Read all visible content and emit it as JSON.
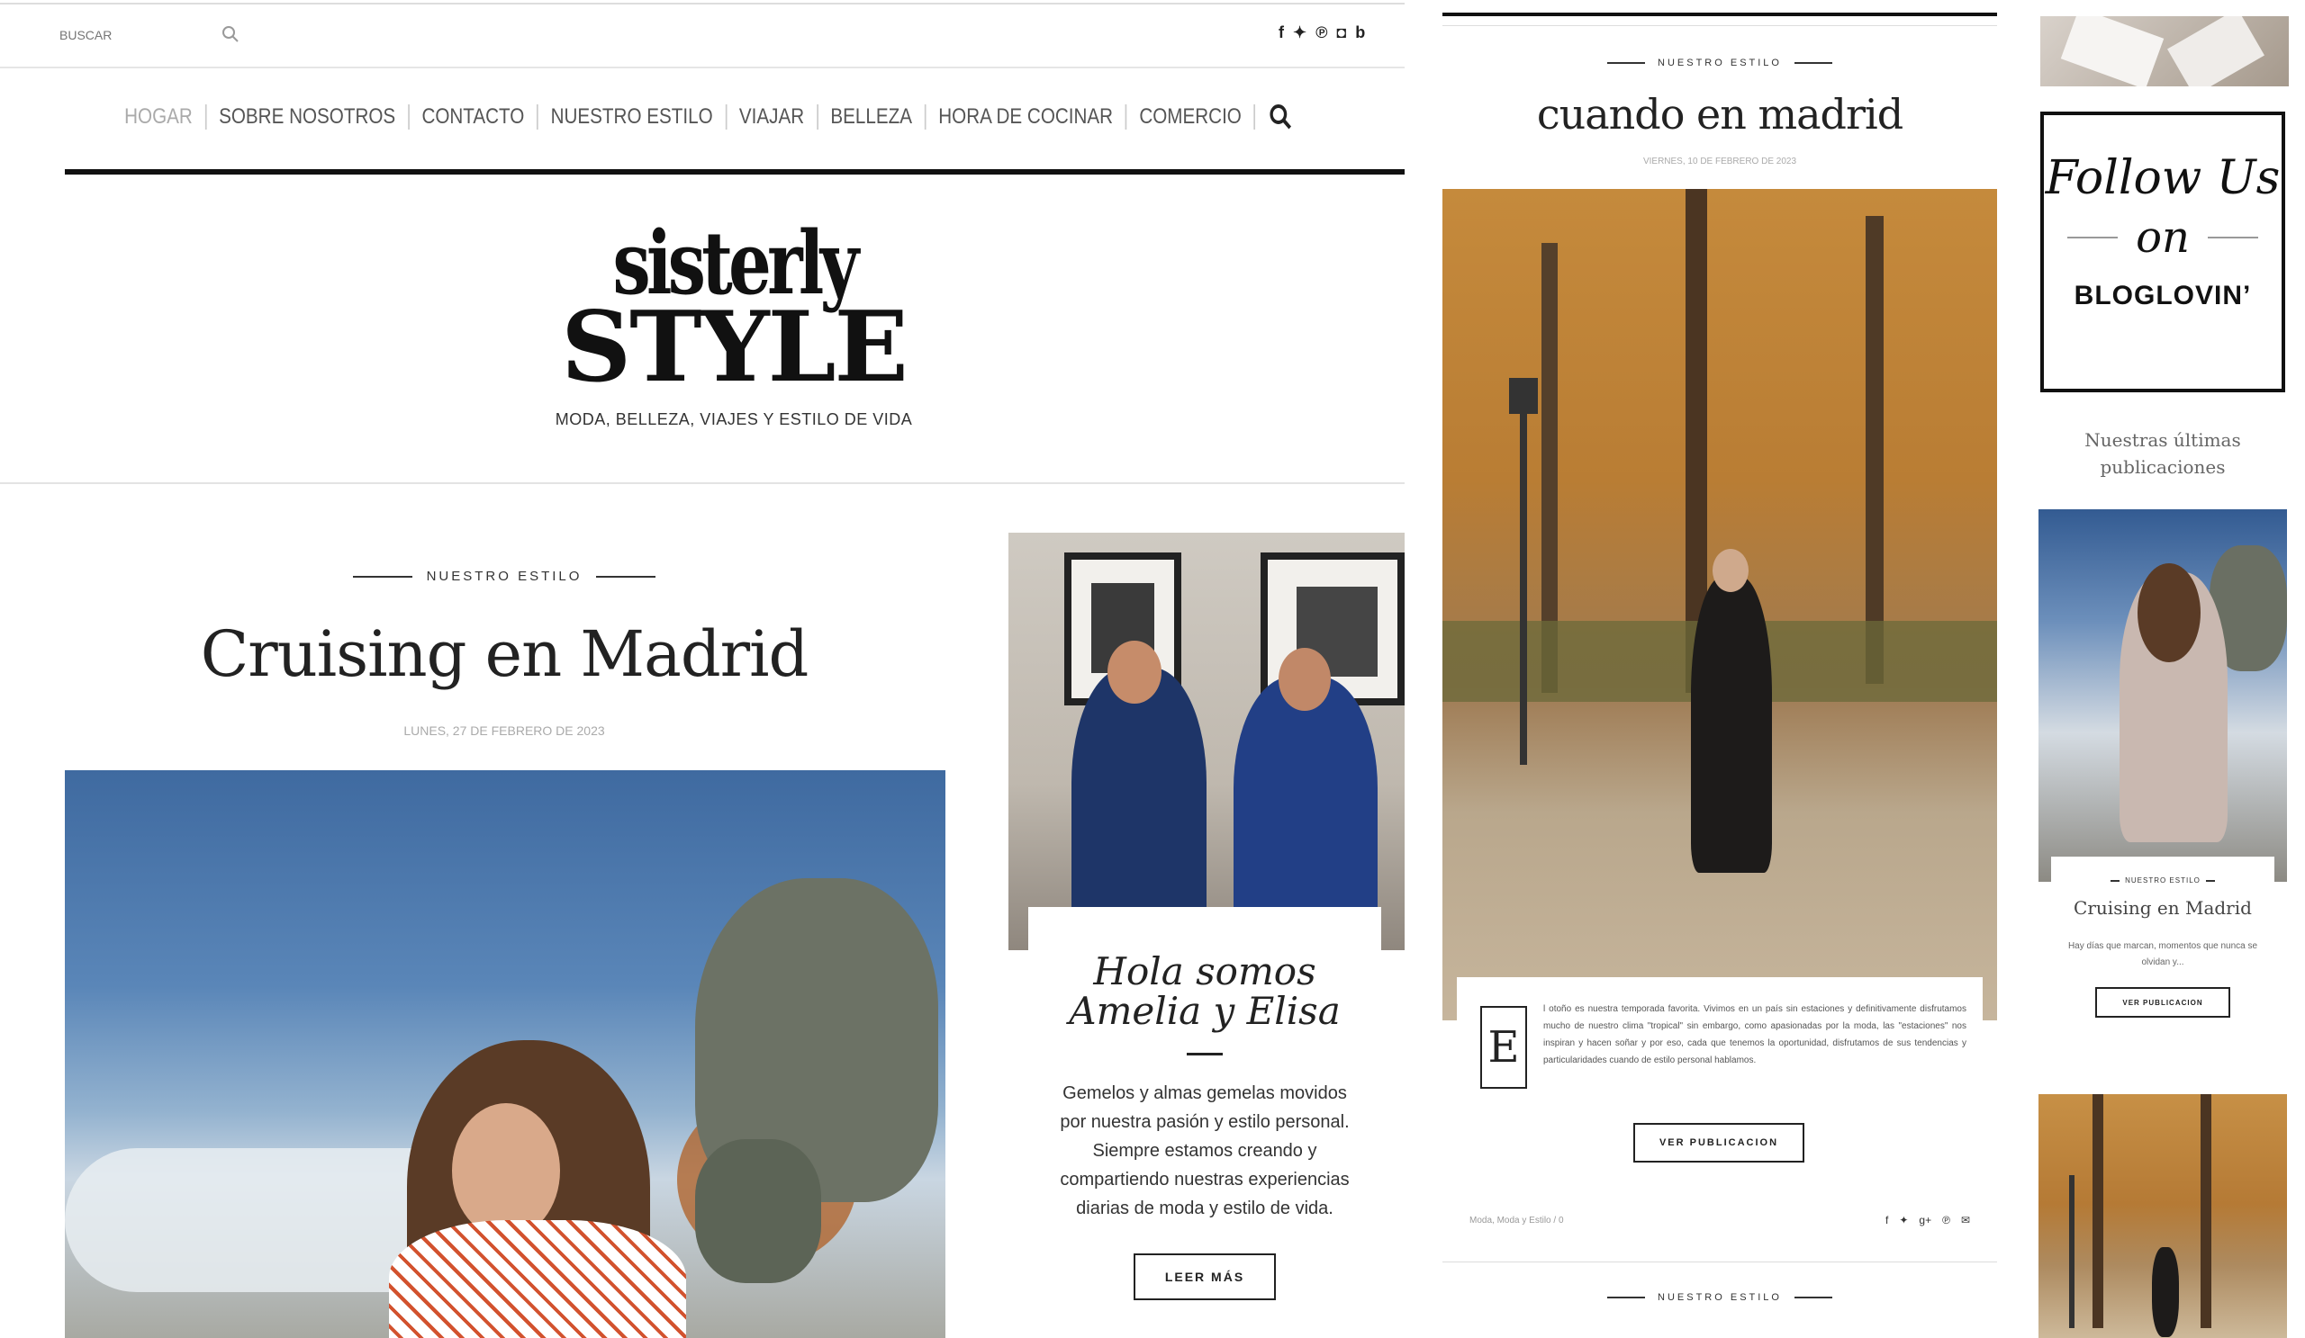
{
  "search": {
    "placeholder": "BUSCAR"
  },
  "social_icons": [
    "facebook-icon",
    "twitter-icon",
    "pinterest-icon",
    "instagram-icon",
    "bloglovin-icon"
  ],
  "nav": {
    "items": [
      "HOGAR",
      "SOBRE NOSOTROS",
      "CONTACTO",
      "NUESTRO ESTILO",
      "VIAJAR",
      "BELLEZA",
      "HORA DE COCINAR",
      "COMERCIO"
    ],
    "active": "HOGAR"
  },
  "logo": {
    "line1": "sisterly",
    "line2": "STYLE",
    "tagline": "MODA, BELLEZA, VIAJES Y ESTILO DE VIDA"
  },
  "featured": {
    "category": "NUESTRO ESTILO",
    "title": "Cruising en Madrid",
    "date": "LUNES, 27 DE FEBRERO DE 2023"
  },
  "about": {
    "title_line1": "Hola somos",
    "title_line2": "Amelia y Elisa",
    "text": "Gemelos y almas gemelas movidos por nuestra pasión y estilo personal. Siempre estamos creando y compartiendo nuestras experiencias diarias de moda y estilo de vida.",
    "button": "LEER MÁS"
  },
  "post2": {
    "category": "NUESTRO ESTILO",
    "title": "cuando en madrid",
    "date": "VIERNES, 10 DE FEBRERO DE 2023",
    "drop_cap": "E",
    "excerpt": "l otoño es nuestra temporada favorita. Vivimos en un país sin estaciones y definitivamente disfrutamos mucho de nuestro clima \"tropical\" sin embargo, como apasionadas por la moda, las \"estaciones\" nos inspiran y hacen soñar y por eso, cada que tenemos la oportunidad, disfrutamos de sus tendencias y particularidades cuando de estilo personal hablamos.",
    "button": "VER PUBLICACION",
    "labels": "Moda, Moda y Estilo",
    "comments": "/ 0"
  },
  "next_category": "NUESTRO ESTILO",
  "sidebar": {
    "follow_line1": "Follow Us",
    "follow_line2": "on",
    "follow_brand": "BLOGLOVIN’",
    "latest_title_line1": "Nuestras últimas",
    "latest_title_line2": "publicaciones",
    "card": {
      "category": "NUESTRO ESTILO",
      "title": "Cruising en Madrid",
      "excerpt": "Hay días que marcan, momentos que nunca se olvidan y...",
      "button": "VER PUBLICACION"
    }
  }
}
